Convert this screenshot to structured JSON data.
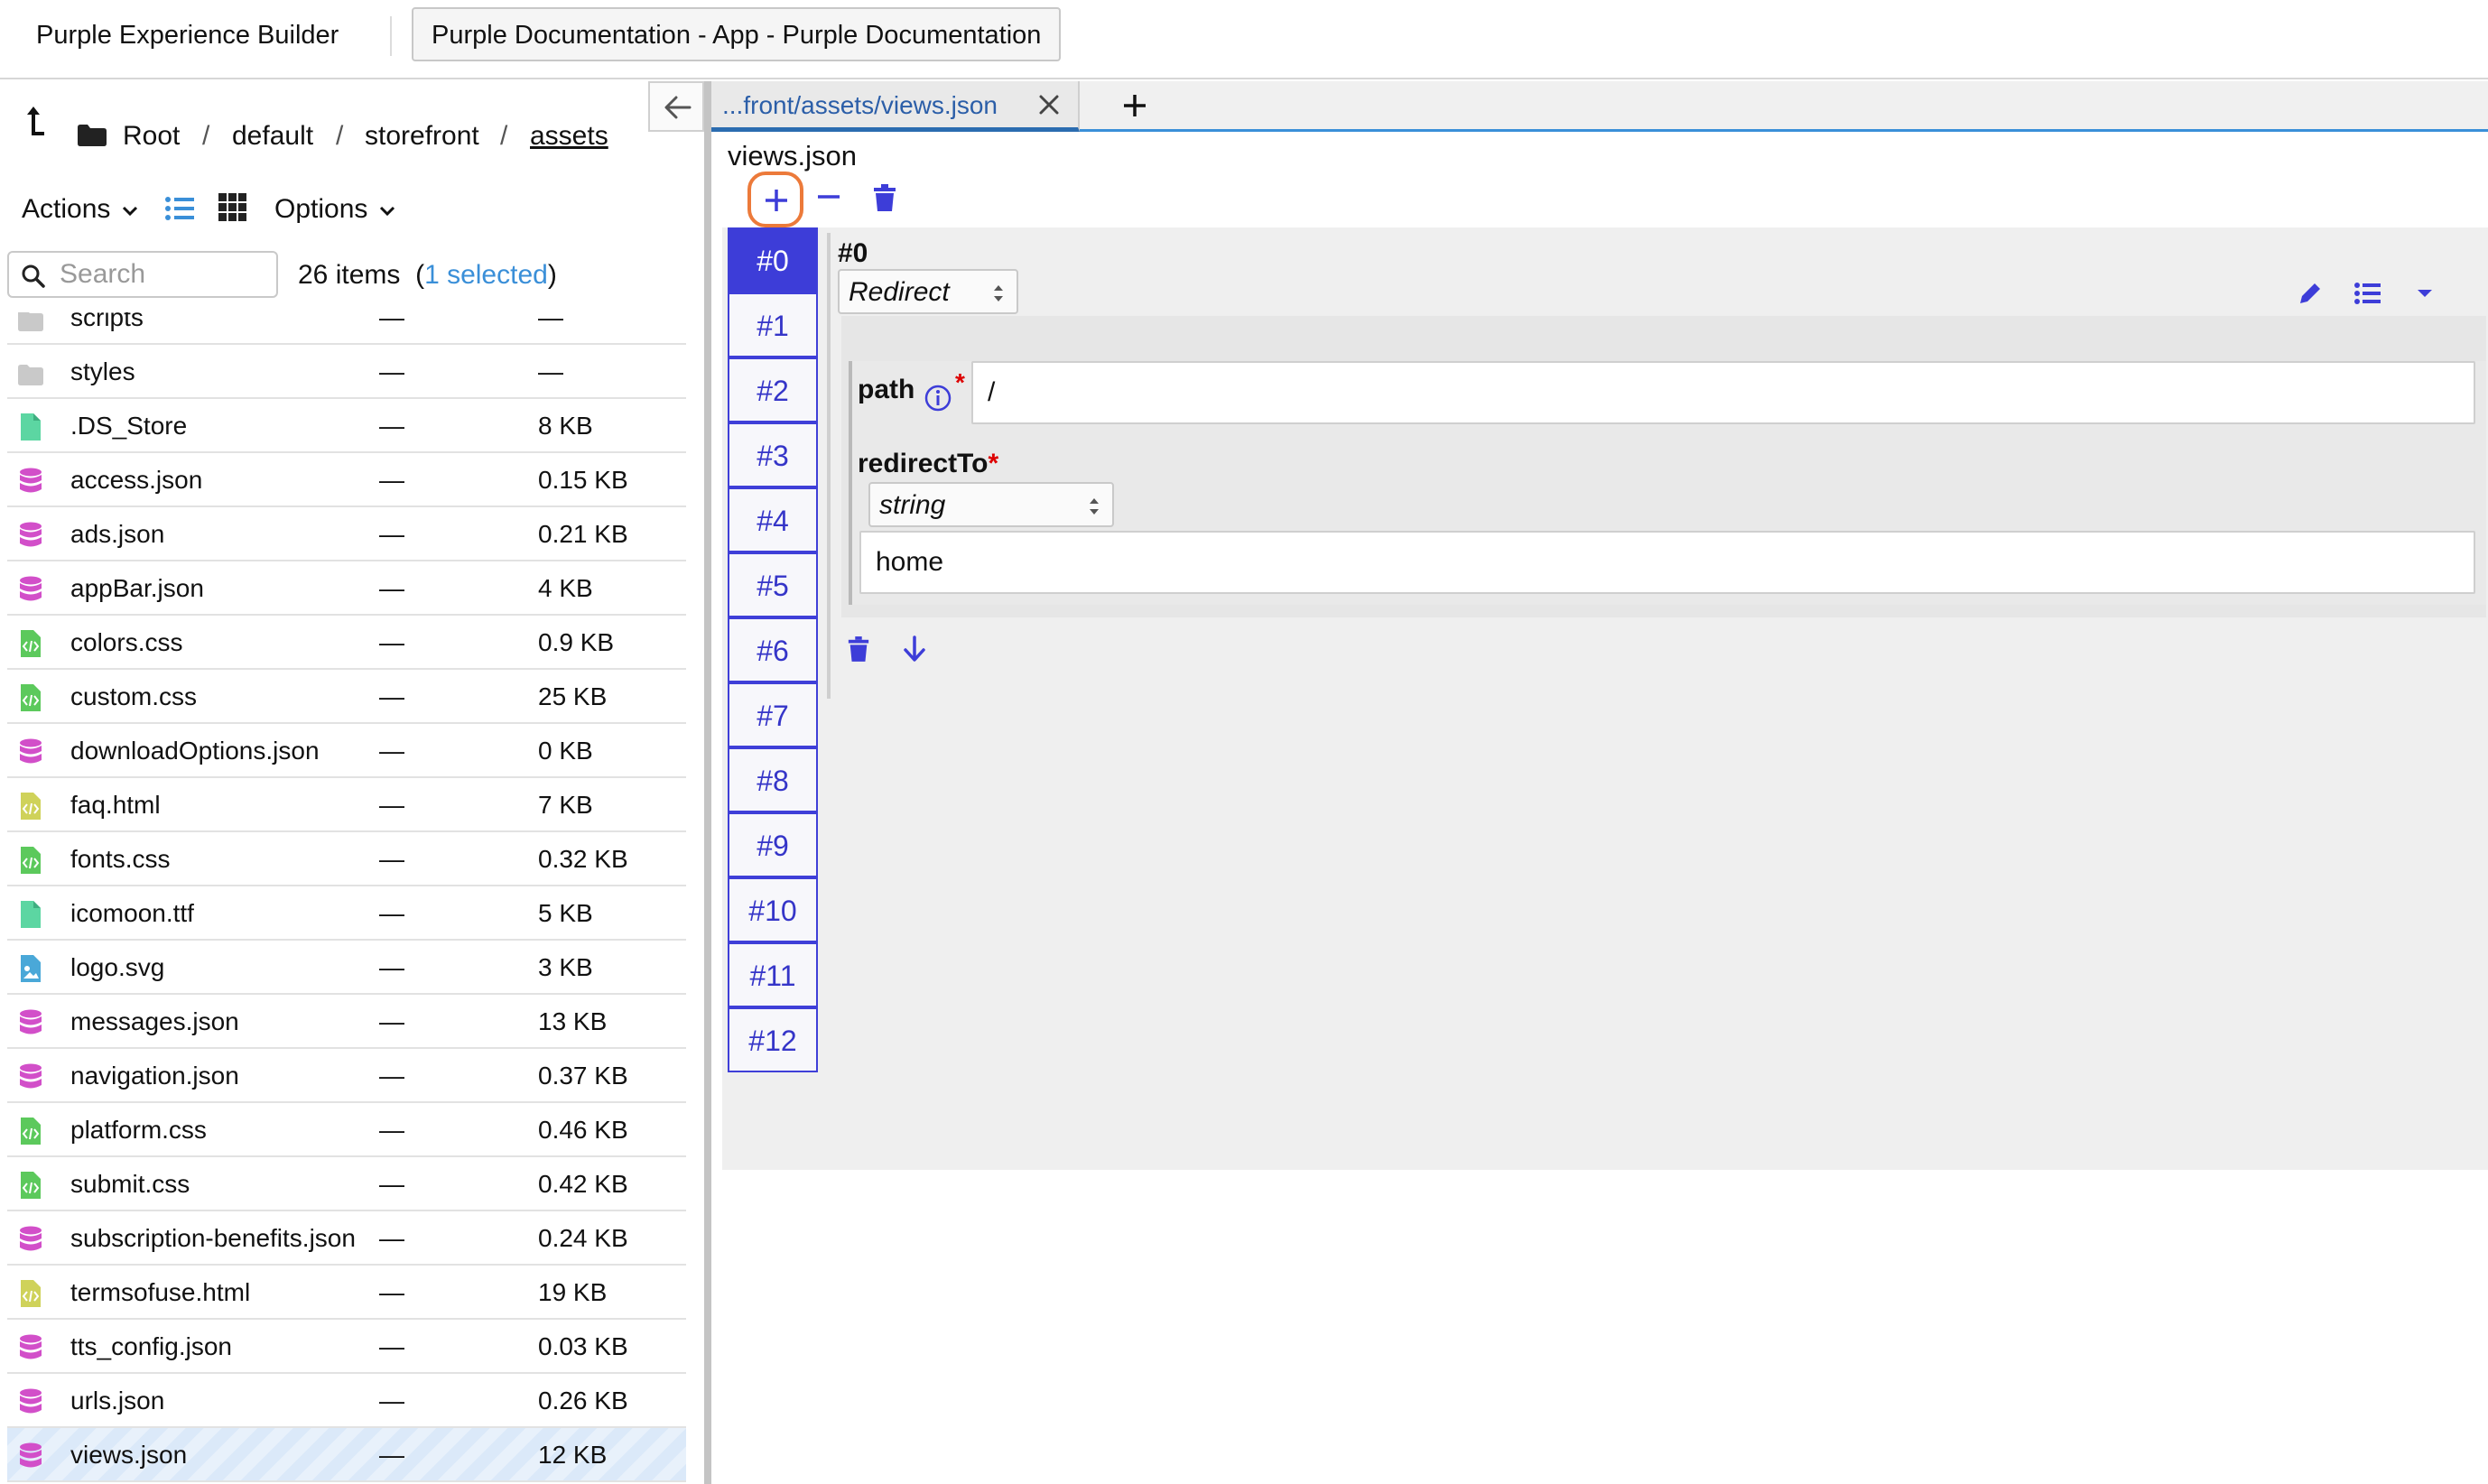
{
  "topbar": {
    "app_title": "Purple Experience Builder",
    "document_button": "Purple Documentation - App - Purple Documentation"
  },
  "breadcrumb": {
    "items": [
      "Root",
      "default",
      "storefront",
      "assets"
    ],
    "separator": "/"
  },
  "toolbar": {
    "actions_label": "Actions",
    "options_label": "Options"
  },
  "search": {
    "placeholder": "Search",
    "count_text": "26 items",
    "selected_text": "1 selected"
  },
  "files": [
    {
      "name": "scripts",
      "date": "—",
      "size": "—",
      "icon": "folder-icon"
    },
    {
      "name": "styles",
      "date": "—",
      "size": "—",
      "icon": "folder-icon"
    },
    {
      "name": ".DS_Store",
      "date": "—",
      "size": "8 KB",
      "icon": "file-icon"
    },
    {
      "name": "access.json",
      "date": "—",
      "size": "0.15 KB",
      "icon": "database-icon"
    },
    {
      "name": "ads.json",
      "date": "—",
      "size": "0.21 KB",
      "icon": "database-icon"
    },
    {
      "name": "appBar.json",
      "date": "—",
      "size": "4 KB",
      "icon": "database-icon"
    },
    {
      "name": "colors.css",
      "date": "—",
      "size": "0.9 KB",
      "icon": "code-file-icon"
    },
    {
      "name": "custom.css",
      "date": "—",
      "size": "25 KB",
      "icon": "code-file-icon"
    },
    {
      "name": "downloadOptions.json",
      "date": "—",
      "size": "0 KB",
      "icon": "database-icon"
    },
    {
      "name": "faq.html",
      "date": "—",
      "size": "7 KB",
      "icon": "html-file-icon"
    },
    {
      "name": "fonts.css",
      "date": "—",
      "size": "0.32 KB",
      "icon": "code-file-icon"
    },
    {
      "name": "icomoon.ttf",
      "date": "—",
      "size": "5 KB",
      "icon": "file-icon"
    },
    {
      "name": "logo.svg",
      "date": "—",
      "size": "3 KB",
      "icon": "image-file-icon"
    },
    {
      "name": "messages.json",
      "date": "—",
      "size": "13 KB",
      "icon": "database-icon"
    },
    {
      "name": "navigation.json",
      "date": "—",
      "size": "0.37 KB",
      "icon": "database-icon"
    },
    {
      "name": "platform.css",
      "date": "—",
      "size": "0.46 KB",
      "icon": "code-file-icon"
    },
    {
      "name": "submit.css",
      "date": "—",
      "size": "0.42 KB",
      "icon": "code-file-icon"
    },
    {
      "name": "subscription-benefits.json",
      "date": "—",
      "size": "0.24 KB",
      "icon": "database-icon"
    },
    {
      "name": "termsofuse.html",
      "date": "—",
      "size": "19 KB",
      "icon": "html-file-icon"
    },
    {
      "name": "tts_config.json",
      "date": "—",
      "size": "0.03 KB",
      "icon": "database-icon"
    },
    {
      "name": "urls.json",
      "date": "—",
      "size": "0.26 KB",
      "icon": "database-icon"
    },
    {
      "name": "views.json",
      "date": "—",
      "size": "12 KB",
      "icon": "database-icon",
      "selected": true
    }
  ],
  "tab": {
    "label": "...front/assets/views.json"
  },
  "editor": {
    "file_title": "views.json",
    "indices": [
      "#0",
      "#1",
      "#2",
      "#3",
      "#4",
      "#5",
      "#6",
      "#7",
      "#8",
      "#9",
      "#10",
      "#11",
      "#12"
    ],
    "active_index": "#0",
    "item_title": "#0",
    "item_type": "Redirect",
    "path_label": "path",
    "path_value": "/",
    "redirect_label": "redirectTo",
    "redirect_type": "string",
    "redirect_value": "home",
    "required_mark": "*"
  },
  "colors": {
    "accent": "#3d3dd8",
    "focus_ring": "#ec7a3a",
    "link": "#3a8fd8",
    "json_icon": "#d24fc9",
    "css_icon": "#5cc95c",
    "html_icon": "#cfd25a",
    "plain_icon": "#5cd6a2",
    "image_icon": "#4aa8d8"
  }
}
